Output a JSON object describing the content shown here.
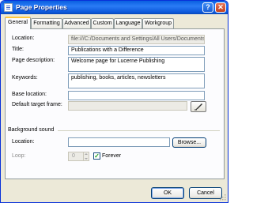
{
  "window": {
    "title": "Page Properties",
    "help_label": "?",
    "close_label": "✕"
  },
  "tabs": [
    {
      "label": "General",
      "active": true
    },
    {
      "label": "Formatting",
      "active": false
    },
    {
      "label": "Advanced",
      "active": false
    },
    {
      "label": "Custom",
      "active": false
    },
    {
      "label": "Language",
      "active": false
    },
    {
      "label": "Workgroup",
      "active": false
    }
  ],
  "general": {
    "location_label": "Location:",
    "location_value": "file:///C:/Documents and Settings/All Users/Documents/My '",
    "title_label": "Title:",
    "title_value": "Publications with a Difference",
    "description_label": "Page description:",
    "description_value": "Welcome page for Lucerne Publishing",
    "keywords_label": "Keywords:",
    "keywords_value": "publishing, books, articles, newsletters",
    "base_location_label": "Base location:",
    "base_location_value": "",
    "target_frame_label": "Default target frame:",
    "target_frame_value": ""
  },
  "background_sound": {
    "group_label": "Background sound",
    "location_label": "Location:",
    "location_value": "",
    "browse_label": "Browse...",
    "loop_label": "Loop:",
    "loop_value": "0",
    "forever_label": "Forever",
    "forever_checked": true,
    "check_mark": "✓"
  },
  "buttons": {
    "ok_label": "OK",
    "cancel_label": "Cancel"
  },
  "colors": {
    "titlebar": "#0a5fe0",
    "dialog_bg": "#ece9d8",
    "active_tab_accent": "#ffc83c",
    "checkmark": "#21a121"
  }
}
